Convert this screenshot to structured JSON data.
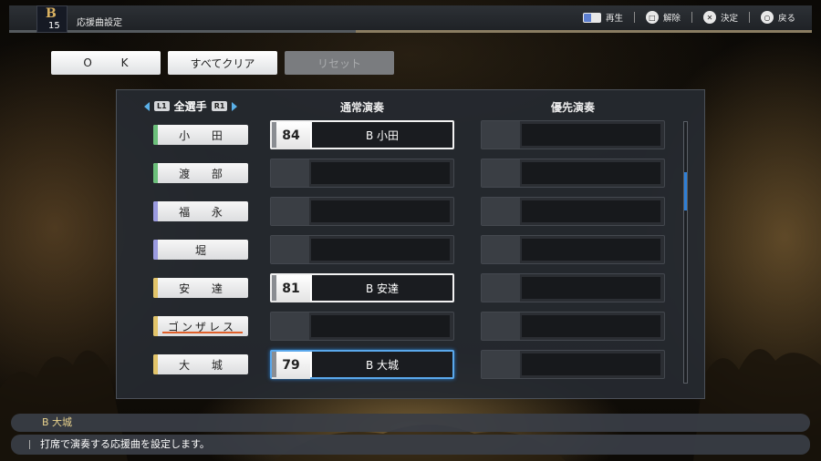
{
  "header": {
    "team_logo": "B",
    "team_number": "15",
    "title": "応援曲設定",
    "controls": [
      {
        "icon": "touchpad-icon",
        "label": "再生"
      },
      {
        "icon": "square-button-icon",
        "label": "解除"
      },
      {
        "icon": "cross-button-icon",
        "label": "決定"
      },
      {
        "icon": "circle-button-icon",
        "label": "戻る"
      }
    ]
  },
  "actions": {
    "ok": "O K",
    "clear_all": "すべてクリア",
    "reset": "リセット"
  },
  "table": {
    "player_filter": {
      "l1": "L1",
      "label": "全選手",
      "r1": "R1"
    },
    "col_normal": "通常演奏",
    "col_priority": "優先演奏",
    "rows": [
      {
        "player": "小 田",
        "tag": "#6bbf7a",
        "normal_num": "84",
        "normal_title": "B 小田",
        "priority_num": "",
        "priority_title": ""
      },
      {
        "player": "渡 部",
        "tag": "#6bbf7a",
        "normal_num": "",
        "normal_title": "",
        "priority_num": "",
        "priority_title": ""
      },
      {
        "player": "福 永",
        "tag": "#9b9be0",
        "normal_num": "",
        "normal_title": "",
        "priority_num": "",
        "priority_title": ""
      },
      {
        "player": "堀",
        "tag": "#9b9be0",
        "normal_num": "",
        "normal_title": "",
        "priority_num": "",
        "priority_title": ""
      },
      {
        "player": "安 達",
        "tag": "#e2c46a",
        "normal_num": "81",
        "normal_title": "B 安達",
        "priority_num": "",
        "priority_title": ""
      },
      {
        "player": "ゴンザレス",
        "tag": "#e2c46a",
        "normal_num": "",
        "normal_title": "",
        "priority_num": "",
        "priority_title": ""
      },
      {
        "player": "大 城",
        "tag": "#e2c46a",
        "normal_num": "79",
        "normal_title": "B 大城",
        "priority_num": "",
        "priority_title": ""
      }
    ]
  },
  "footer": {
    "selected_song": "B 大城",
    "help_text": "打席で演奏する応援曲を設定します。"
  },
  "colors": {
    "selection": "#5aa8ec",
    "accent_gold": "#e9d38e"
  }
}
